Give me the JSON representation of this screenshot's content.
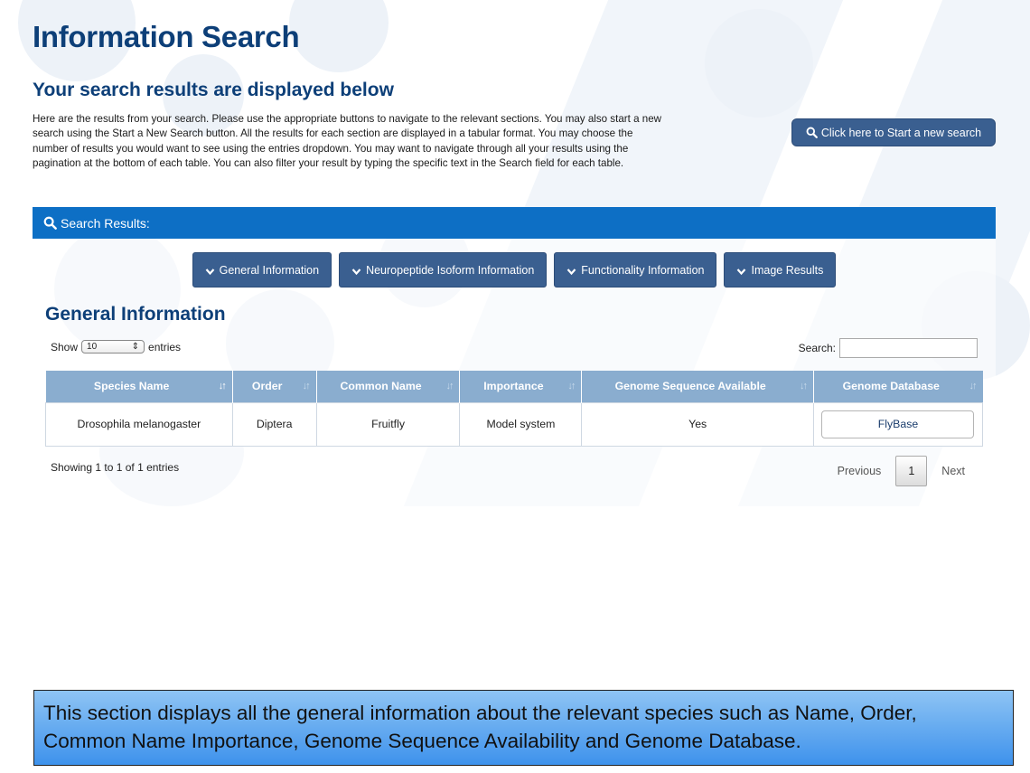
{
  "page": {
    "title": "Information Search",
    "subtitle": "Your search results are displayed below",
    "intro": "Here are the results from your search. Please use the appropriate buttons to navigate to the relevant sections. You may also start a new search using the Start a New Search button. All the results for each section are displayed in a tabular format. You may choose the number of results you would want to see using the entries dropdown. You may want to navigate through all your results using the pagination at the bottom of each table. You can also filter your result by typing the specific text in the Search field for each table.",
    "new_search_label": "Click here to Start a new search"
  },
  "results": {
    "bar_label": "Search Results:",
    "nav": [
      {
        "label": "General Information"
      },
      {
        "label": "Neuropeptide Isoform Information"
      },
      {
        "label": "Functionality Information"
      },
      {
        "label": "Image Results"
      }
    ]
  },
  "general": {
    "section_title": "General Information",
    "show_label": "Show",
    "entries_value": "10",
    "entries_label": "entries",
    "search_label": "Search:",
    "search_value": "",
    "columns": [
      "Species Name",
      "Order",
      "Common Name",
      "Importance",
      "Genome Sequence Available",
      "Genome Database"
    ],
    "rows": [
      {
        "species": "Drosophila melanogaster",
        "order": "Diptera",
        "common_name": "Fruitfly",
        "importance": "Model system",
        "genome_available": "Yes",
        "database": "FlyBase"
      }
    ],
    "info": "Showing 1 to 1 of 1 entries",
    "pagination": {
      "previous": "Previous",
      "current": "1",
      "next": "Next"
    }
  },
  "caption": "This section displays all the general information about the relevant species such as Name, Order, Common Name Importance, Genome Sequence Availability and Genome Database.",
  "colors": {
    "heading": "#0d3f78",
    "button": "#3a5f90",
    "results_bar": "#0d6fc5",
    "table_header": "#8aadcf",
    "caption_bg": "#3e92ec"
  }
}
